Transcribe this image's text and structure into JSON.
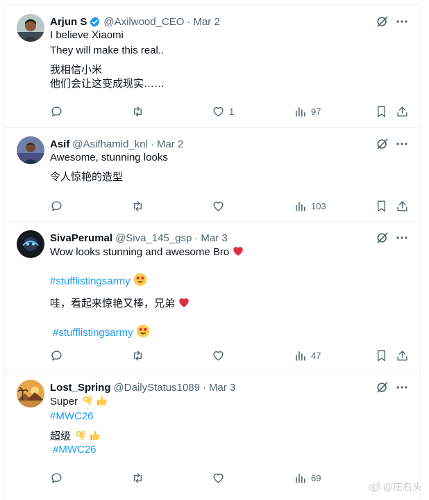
{
  "tweets": [
    {
      "name": "Arjun S",
      "handle": "@Axilwood_CEO",
      "separator": "·",
      "date": "Mar 2",
      "lines": [
        "I believe Xiaomi",
        "They will make this real..",
        "我相信小米",
        "他们会让这变成现实……"
      ],
      "replies": "",
      "retweets": "",
      "likes": "1",
      "views": "97"
    },
    {
      "name": "Asif",
      "handle": "@Asifhamid_knl",
      "separator": "·",
      "date": "Mar 2",
      "lines": [
        "Awesome, stunning looks",
        "令人惊艳的造型"
      ],
      "replies": "",
      "retweets": "",
      "likes": "",
      "views": "103"
    },
    {
      "name": "SivaPerumal",
      "handle": "@Siva_145_gsp",
      "separator": "·",
      "date": "Mar 3",
      "lines": [
        "Wow looks stunning and awesome Bro",
        "#stufflistingsarmy",
        "哇，看起来惊艳又棒，兄弟",
        "#stufflistingsarmy"
      ],
      "replies": "",
      "retweets": "",
      "likes": "",
      "views": "47"
    },
    {
      "name": "Lost_Spring",
      "handle": "@DailyStatus1089",
      "separator": "·",
      "date": "Mar 3",
      "lines": [
        "Super",
        "#MWC26",
        "超级",
        "#MWC26"
      ],
      "replies": "",
      "retweets": "",
      "likes": "",
      "views": "69"
    }
  ],
  "watermark": "@庄右头",
  "colors": {
    "text": "#0f1419",
    "secondary": "#536471",
    "link": "#1d9bf0",
    "verified": "#1d9bf0",
    "heart": "#e0245e"
  },
  "icons": [
    "verified-badge-icon",
    "grok-icon",
    "more-icon",
    "reply-icon",
    "retweet-icon",
    "like-icon",
    "views-icon",
    "bookmark-icon",
    "share-icon",
    "heart-emoji",
    "heart-eyes-emoji",
    "ok-hand-emoji",
    "thumbs-up-emoji"
  ]
}
